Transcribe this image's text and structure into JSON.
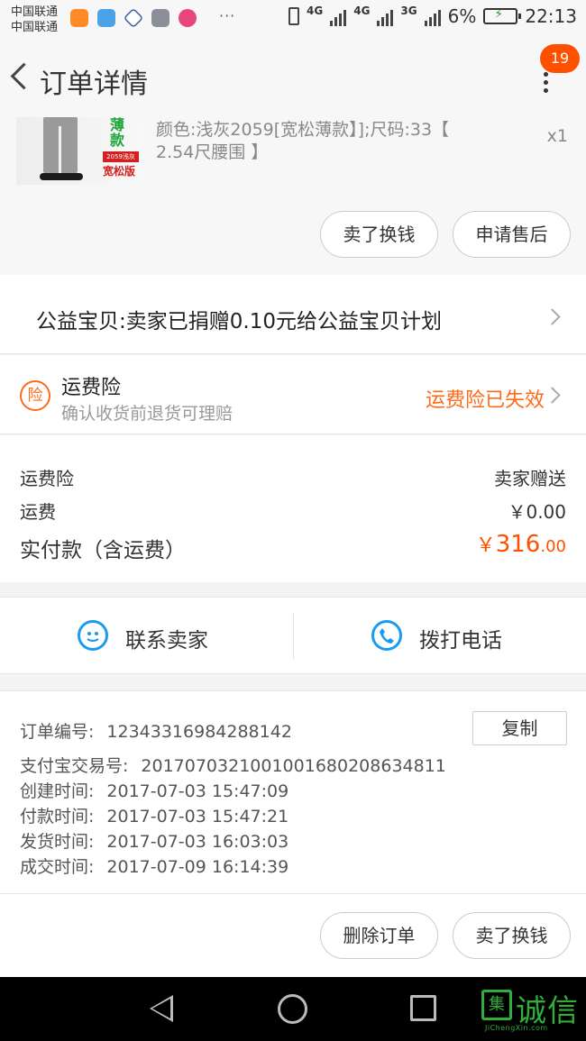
{
  "status_bar": {
    "carrier_1": "中国联通",
    "carrier_2": "中国联通",
    "more_dots": "···",
    "network_1": "4G",
    "network_2": "4G",
    "network_3": "3G",
    "battery": "6%",
    "time": "22:13"
  },
  "header": {
    "title": "订单详情",
    "notification_count": "19"
  },
  "product": {
    "thumb_tag_1": "薄款",
    "thumb_tag_2": "2059浅灰",
    "thumb_tag_3": "宽松版",
    "sku": "颜色:浅灰2059[宽松薄款】];尺码:33【 2.54尺腰围 】",
    "quantity": "x1",
    "sell_button": "卖了换钱",
    "after_sale_button": "申请售后"
  },
  "charity": {
    "text": "公益宝贝:卖家已捐赠0.10元给公益宝贝计划"
  },
  "insurance": {
    "icon_char": "险",
    "title": "运费险",
    "subtitle": "确认收货前退货可理赔",
    "status": "运费险已失效",
    "status_color": "#ff6a1a"
  },
  "fees": {
    "rows": [
      {
        "label": "运费险",
        "value": "卖家赠送"
      },
      {
        "label": "运费",
        "value": "￥0.00"
      }
    ],
    "paid_label": "实付款（含运费）",
    "paid_currency": "￥",
    "paid_integer": "316",
    "paid_decimal": ".00",
    "accent_color": "#ff5000"
  },
  "contact": {
    "seller_label": "联系卖家",
    "phone_label": "拨打电话"
  },
  "order_info": {
    "copy_button": "复制",
    "rows": [
      {
        "key": "订单编号:",
        "value": "12343316984288142"
      },
      {
        "key": "支付宝交易号:",
        "value": "2017070321001001680208634811"
      },
      {
        "key": "创建时间:",
        "value": "2017-07-03 15:47:09"
      },
      {
        "key": "付款时间:",
        "value": "2017-07-03 15:47:21"
      },
      {
        "key": "发货时间:",
        "value": "2017-07-03 16:03:03"
      },
      {
        "key": "成交时间:",
        "value": "2017-07-09 16:14:39"
      }
    ]
  },
  "actions": {
    "delete_button": "删除订单",
    "sell_button": "卖了换钱"
  },
  "watermark": {
    "box_char": "集",
    "text": "诚信",
    "sub": "JiChengXin.com"
  }
}
